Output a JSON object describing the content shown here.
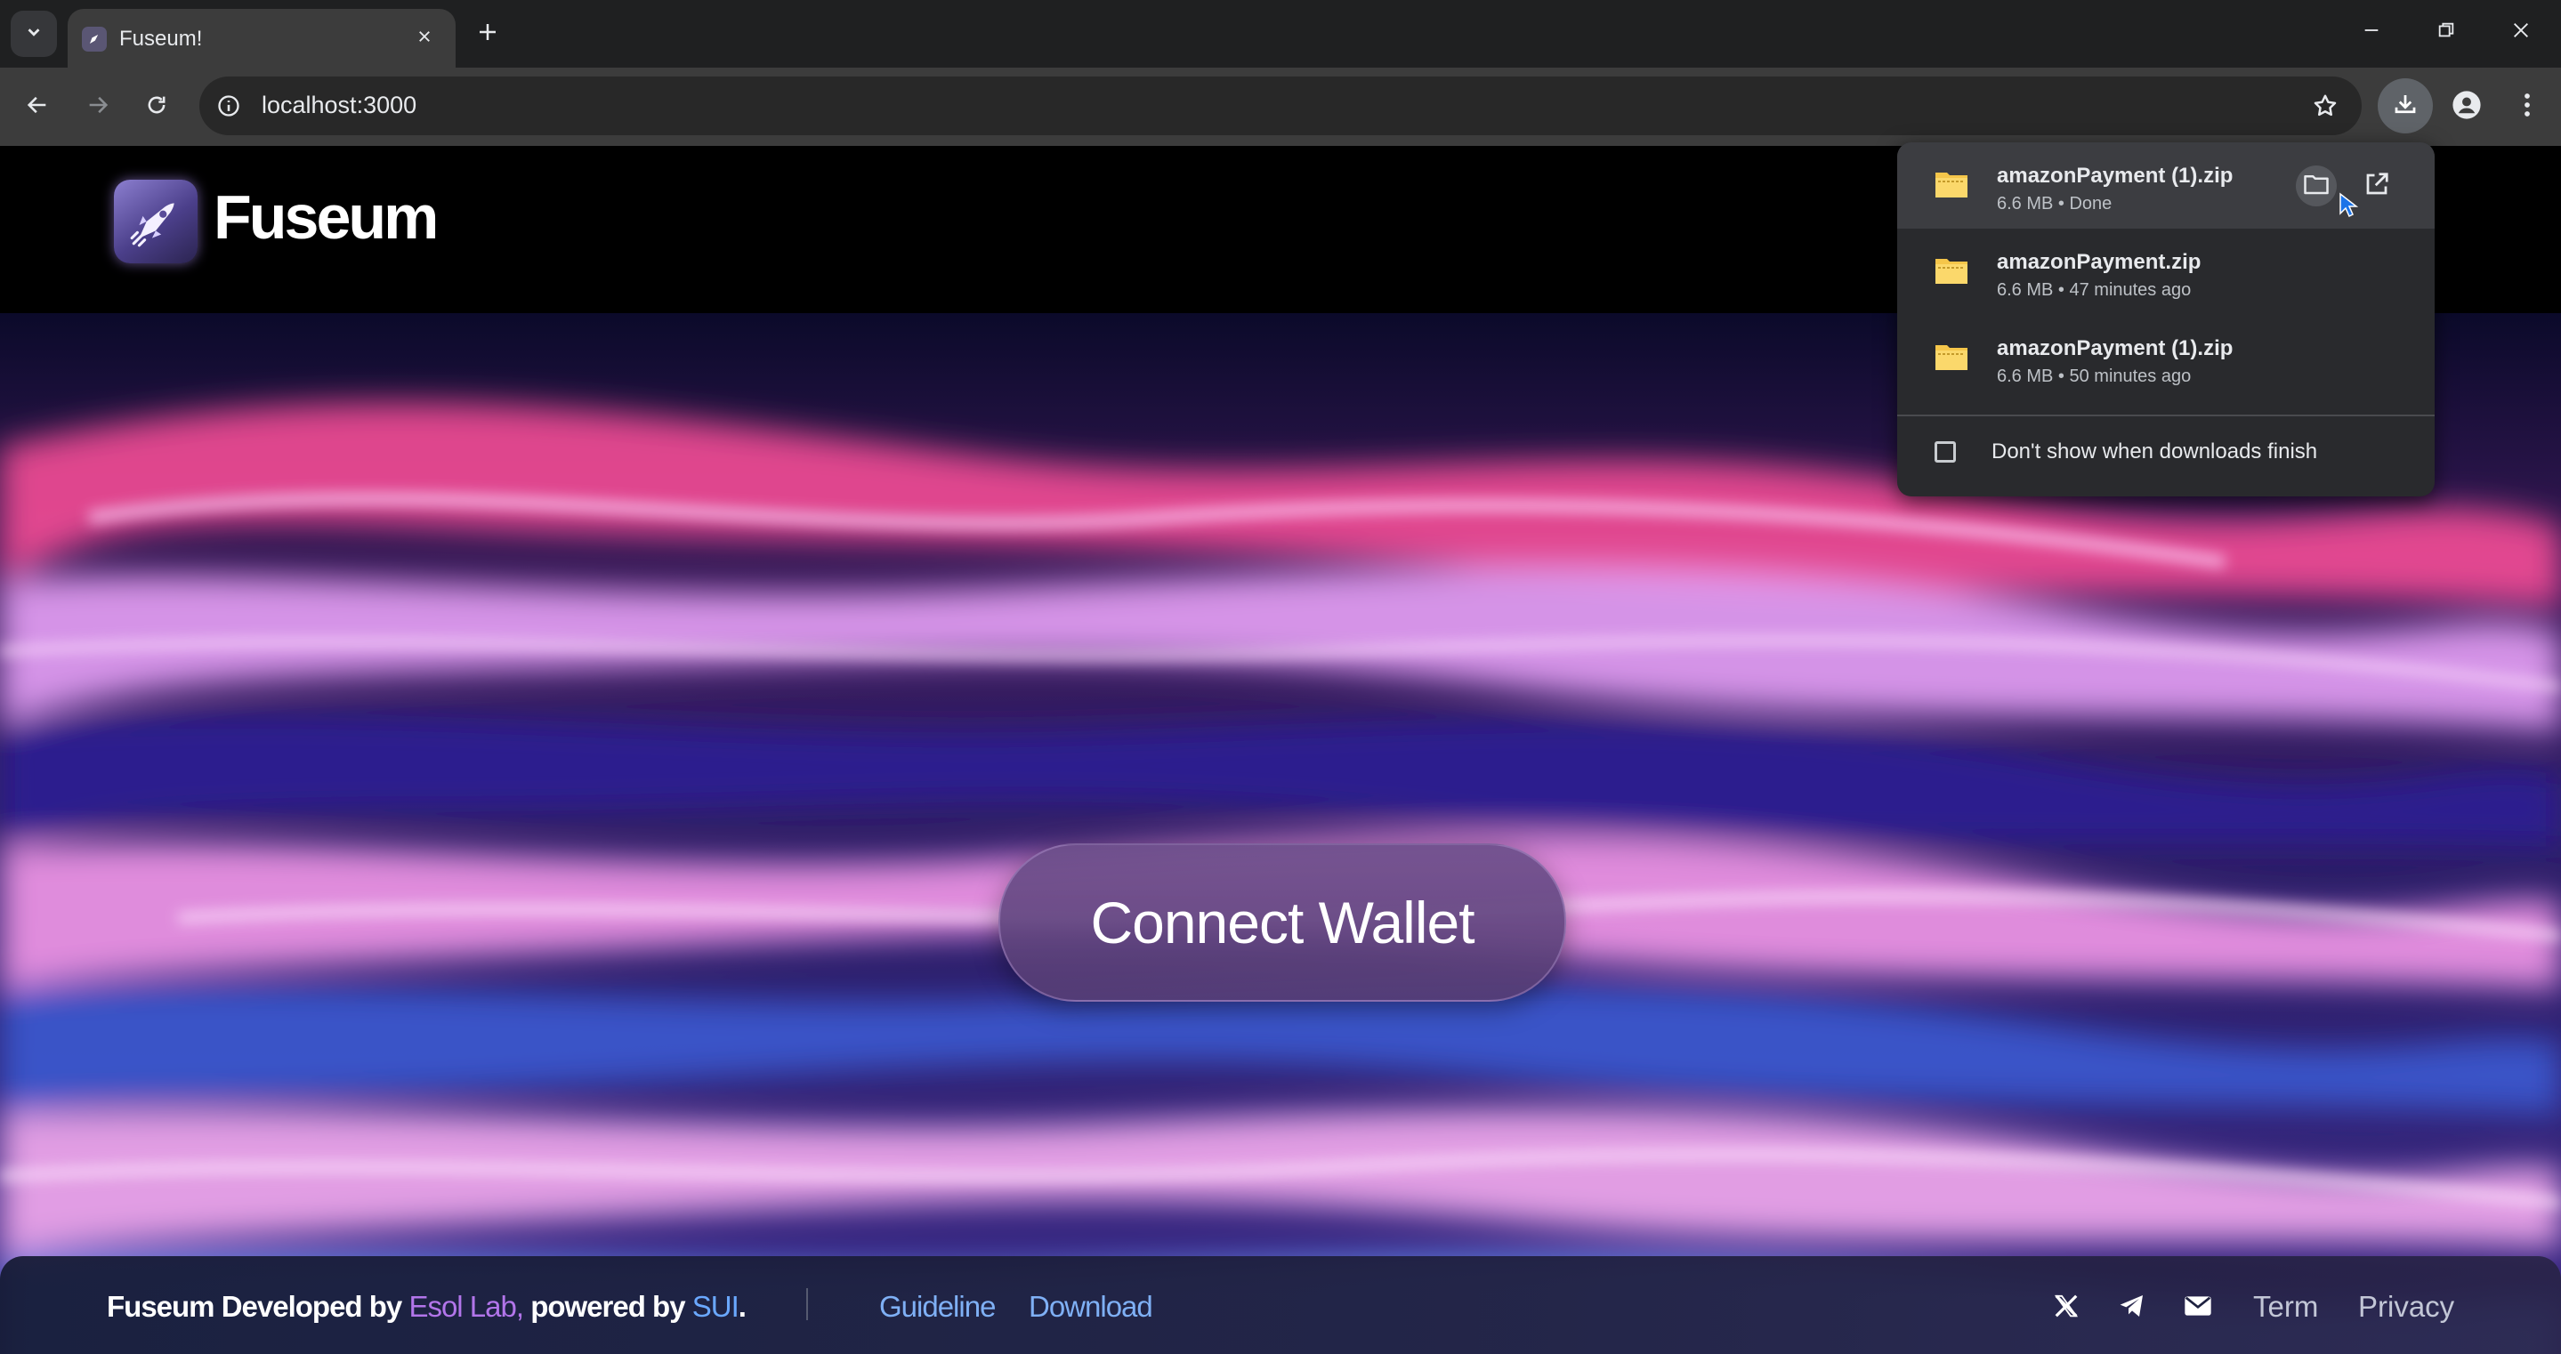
{
  "browser": {
    "tab_title": "Fuseum!",
    "url": "localhost:3000"
  },
  "site": {
    "logo_text": "Fuseum",
    "connect_label": "Connect Wallet"
  },
  "footer": {
    "credit_prefix": "Fuseum Developed by ",
    "credit_lab": "Esol Lab,",
    "credit_mid": " powered by ",
    "credit_sui": "SUI",
    "credit_end": ".",
    "links": [
      "Guideline",
      "Download"
    ],
    "right_links": [
      "Term",
      "Privacy"
    ]
  },
  "downloads": {
    "items": [
      {
        "name": "amazonPayment (1).zip",
        "meta": "6.6 MB • Done"
      },
      {
        "name": "amazonPayment.zip",
        "meta": "6.6 MB • 47 minutes ago"
      },
      {
        "name": "amazonPayment (1).zip",
        "meta": "6.6 MB • 50 minutes ago"
      }
    ],
    "checkbox_label": "Don't show when downloads finish",
    "checkbox_checked": false
  },
  "colors": {
    "accent_purple": "#b275ea",
    "accent_blue": "#6aa8ff",
    "link_blue": "#7fb0f5"
  }
}
